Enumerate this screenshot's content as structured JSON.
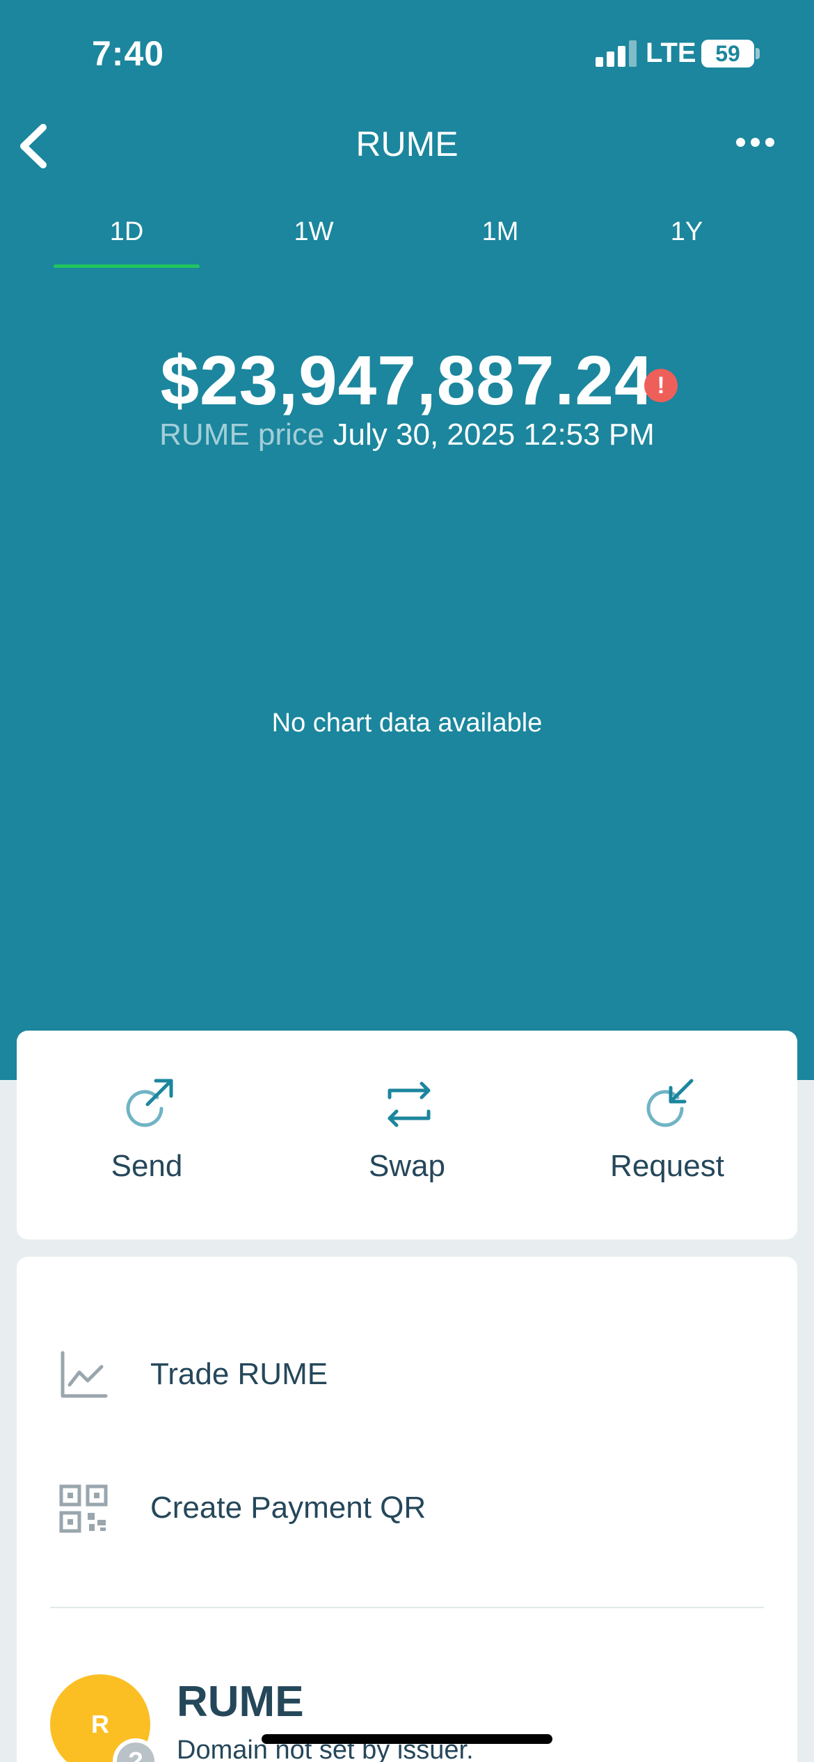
{
  "status_bar": {
    "time": "7:40",
    "network": "LTE",
    "battery": "59"
  },
  "nav": {
    "title": "RUME",
    "back_icon": "chevron-left-icon",
    "more_icon": "ellipsis-icon"
  },
  "tabs": [
    {
      "label": "1D",
      "selected": true
    },
    {
      "label": "1W",
      "selected": false
    },
    {
      "label": "1M",
      "selected": false
    },
    {
      "label": "1Y",
      "selected": false
    }
  ],
  "price": {
    "value": "$23,947,887.24",
    "label": "RUME price",
    "timestamp": "July 30, 2025 12:53 PM",
    "warning_icon": "exclamation-icon"
  },
  "chart": {
    "empty_message": "No chart data available"
  },
  "actions": [
    {
      "label": "Send",
      "icon": "send-icon"
    },
    {
      "label": "Swap",
      "icon": "swap-icon"
    },
    {
      "label": "Request",
      "icon": "request-icon"
    }
  ],
  "options": [
    {
      "label": "Trade RUME",
      "icon": "chart-line-icon"
    },
    {
      "label": "Create Payment QR",
      "icon": "qr-code-icon"
    }
  ],
  "asset": {
    "avatar_letter": "R",
    "name": "RUME",
    "domain": "Domain not set by issuer.",
    "badge": "?"
  },
  "colors": {
    "header": "#1b869d",
    "tab_indicator": "#22c55e",
    "warning": "#ef5f5a",
    "avatar": "#fbbf24",
    "text_dark": "#25475a"
  }
}
